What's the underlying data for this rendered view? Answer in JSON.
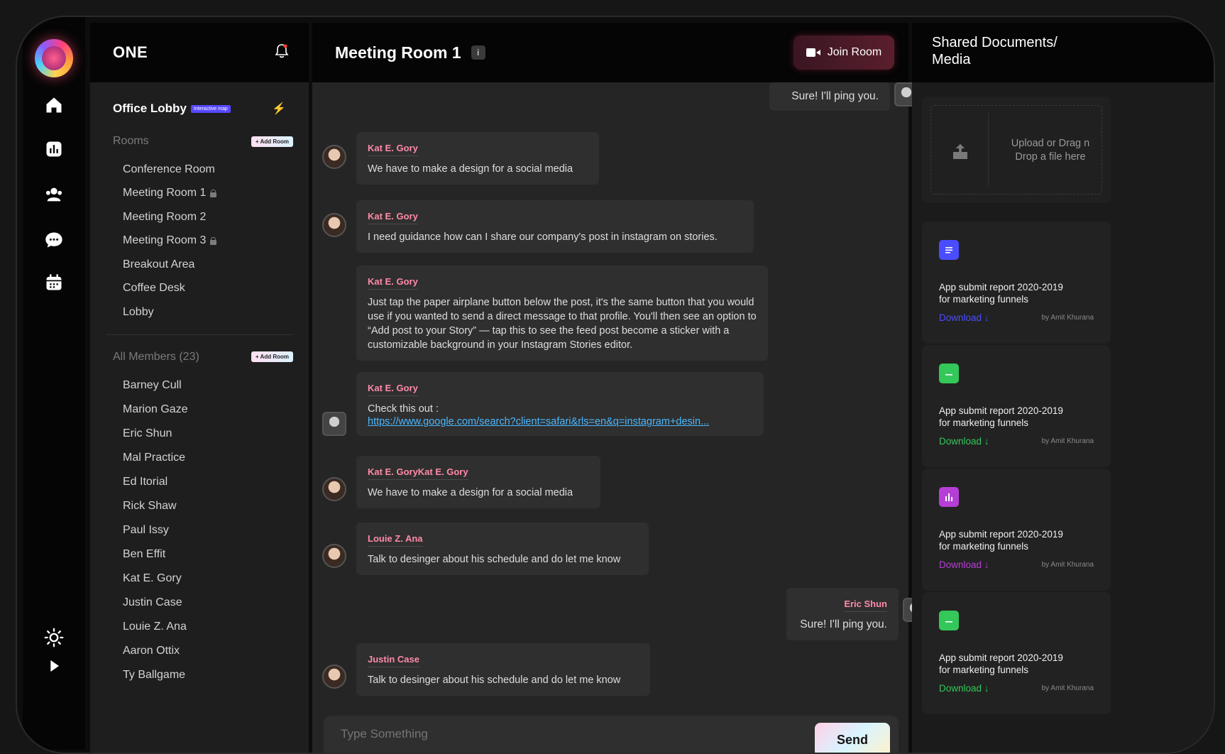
{
  "app": {
    "brand": "ONE"
  },
  "rail": {
    "icons": [
      "home-icon",
      "analytics-icon",
      "people-icon",
      "chat-icon",
      "calendar-icon",
      "sun-icon",
      "play-icon"
    ]
  },
  "sidebar": {
    "lobby_title": "Office Lobby",
    "lobby_tag": "Interactive map",
    "rooms_title": "Rooms",
    "add_room_label": "+ Add Room",
    "rooms": [
      {
        "label": "Conference Room",
        "locked": false
      },
      {
        "label": "Meeting Room 1",
        "locked": true
      },
      {
        "label": "Meeting Room 2",
        "locked": false
      },
      {
        "label": "Meeting Room 3",
        "locked": true
      },
      {
        "label": "Breakout Area",
        "locked": false
      },
      {
        "label": "Coffee Desk",
        "locked": false
      },
      {
        "label": "Lobby",
        "locked": false
      }
    ],
    "members_title": "All Members (23)",
    "members_add_label": "+ Add Room",
    "members": [
      "Barney Cull",
      "Marion Gaze",
      "Eric Shun",
      "Mal Practice",
      "Ed Itorial",
      "Rick Shaw",
      "Paul Issy",
      "Ben Effit",
      "Kat E. Gory",
      "Justin Case",
      "Louie Z. Ana",
      "Aaron Ottix",
      "Ty Ballgame"
    ]
  },
  "chat": {
    "title": "Meeting Room 1",
    "info_icon": "i",
    "join_label": "Join Room",
    "messages": [
      {
        "sender": "",
        "text": "Sure! I'll ping you.",
        "mine": true
      },
      {
        "sender": "Kat E. Gory",
        "text": "We have to make a design for a social media"
      },
      {
        "sender": "Kat E. Gory",
        "text": "I need guidance how can I share our company's post in instagram on stories."
      },
      {
        "sender": "Kat E. Gory",
        "text": "Just tap the paper airplane button below the post, it's the same button that you would use if you wanted to send a direct message to that profile. You'll then see an option to “Add post to your Story” — tap this to see the feed post become a sticker with a customizable background in your Instagram Stories editor."
      },
      {
        "sender": "Kat E. Gory",
        "text": "Check this out :",
        "link": "https://www.google.com/search?client=safari&rls=en&q=instagram+desin..."
      },
      {
        "sender": "Kat E. GoryKat E. Gory",
        "text": "We have to make a design for a social media"
      },
      {
        "sender": "Louie Z. Ana",
        "text": "Talk to desinger about his schedule and do let me know"
      },
      {
        "sender": "Eric Shun",
        "text": "Sure! I'll ping you.",
        "mine": true
      },
      {
        "sender": "Justin Case",
        "text": "Talk to desinger about his schedule and do let me know"
      }
    ],
    "composer_placeholder": "Type Something",
    "send_label": "Send"
  },
  "docs": {
    "title_line1": "Shared Documents/",
    "title_line2": "Media",
    "upload_line1": "Upload or Drag n",
    "upload_line2": "Drop a file here",
    "cards": [
      {
        "line1": "App submit report 2020-2019",
        "line2": "for marketing funnels",
        "download": "Download ↓",
        "by": "by Amit Khurana",
        "color": "#4a4cff",
        "icon": "document-icon"
      },
      {
        "line1": "App submit report 2020-2019",
        "line2": "for marketing funnels",
        "download": "Download ↓",
        "by": "by Amit Khurana",
        "color": "#34c759",
        "icon": "folder-icon"
      },
      {
        "line1": "App submit report 2020-2019",
        "line2": "for marketing funnels",
        "download": "Download ↓",
        "by": "by Amit Khurana",
        "color": "#b53fd6",
        "icon": "chart-icon"
      },
      {
        "line1": "App submit report 2020-2019",
        "line2": "for marketing funnels",
        "download": "Download ↓",
        "by": "by Amit Khurana",
        "color": "#34c759",
        "icon": "folder-icon"
      }
    ]
  }
}
